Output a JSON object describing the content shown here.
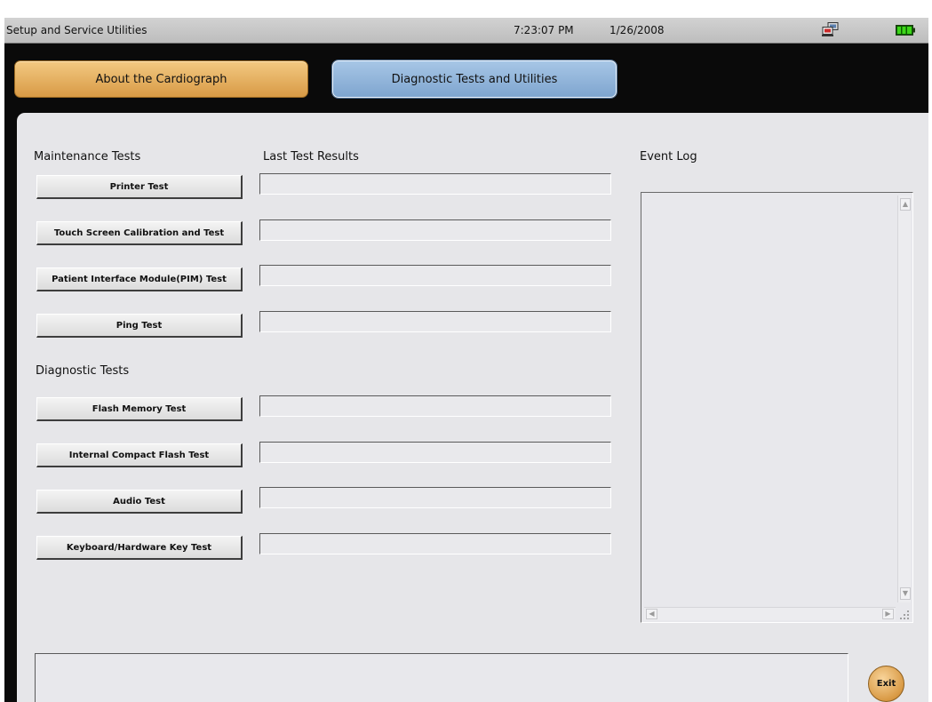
{
  "titlebar": {
    "app_title": "Setup and Service Utilities",
    "time": "7:23:07 PM",
    "date": "1/26/2008",
    "network_icon": "network-status-icon",
    "battery_icon": "battery-icon",
    "battery_color": "#22b400"
  },
  "tabs": [
    {
      "label": "About the Cardiograph",
      "active": false,
      "color": "#e9b566"
    },
    {
      "label": "Diagnostic Tests and Utilities",
      "active": true,
      "color": "#8fb3da"
    }
  ],
  "sections": {
    "maintenance_title": "Maintenance Tests",
    "results_title": "Last Test Results",
    "event_log_title": "Event Log",
    "diagnostic_title": "Diagnostic Tests"
  },
  "maintenance_tests": [
    {
      "label": "Printer Test",
      "result": ""
    },
    {
      "label": "Touch Screen Calibration and Test",
      "result": ""
    },
    {
      "label": "Patient Interface Module(PIM) Test",
      "result": ""
    },
    {
      "label": "Ping Test",
      "result": ""
    }
  ],
  "diagnostic_tests": [
    {
      "label": "Flash Memory Test",
      "result": ""
    },
    {
      "label": "Internal Compact Flash Test",
      "result": ""
    },
    {
      "label": "Audio Test",
      "result": ""
    },
    {
      "label": "Keyboard/Hardware Key Test",
      "result": ""
    }
  ],
  "event_log": {
    "text": ""
  },
  "status_message": "",
  "exit_label": "Exit"
}
